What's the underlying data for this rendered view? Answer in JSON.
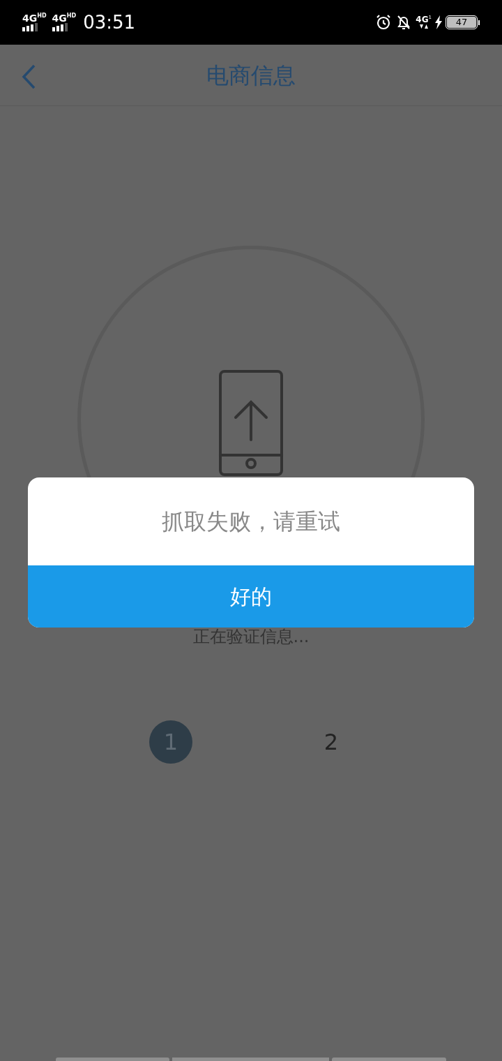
{
  "status_bar": {
    "sims": [
      {
        "network": "4G",
        "badge": "HD"
      },
      {
        "network": "4G",
        "badge": "HD"
      }
    ],
    "time": "03:51",
    "data_network": "4G",
    "data_slot": "1",
    "battery": "47"
  },
  "header": {
    "title": "电商信息"
  },
  "status_text": "正在验证信息...",
  "steps": [
    {
      "label": "1",
      "selected": true
    },
    {
      "label": "2",
      "selected": false
    }
  ],
  "dialog": {
    "message": "抓取失败，请重试",
    "button": "好的"
  }
}
